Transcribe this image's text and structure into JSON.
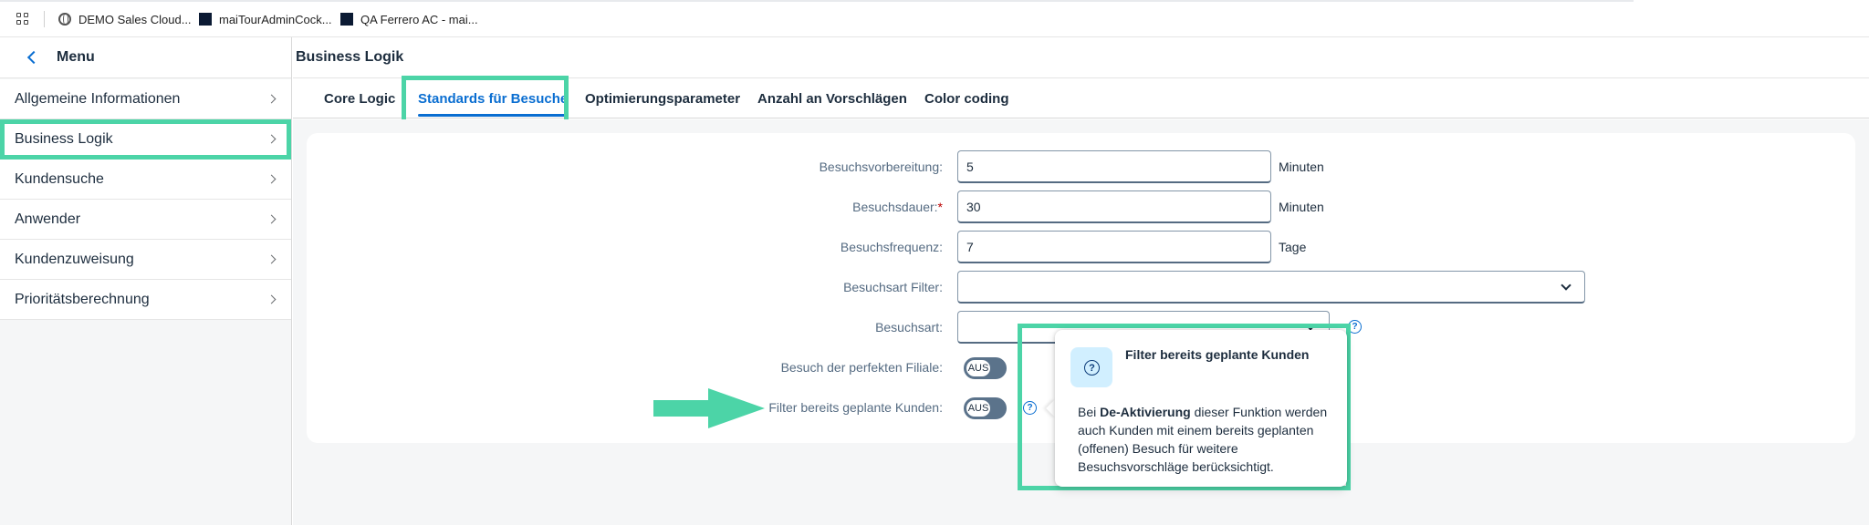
{
  "bookmarks": [
    {
      "label": "DEMO Sales Cloud...",
      "icon": "globe-icon"
    },
    {
      "label": "maiTourAdminCock...",
      "icon": "app-square-icon"
    },
    {
      "label": "QA Ferrero AC - mai...",
      "icon": "app-square-icon"
    }
  ],
  "sidebar": {
    "title": "Menu",
    "items": [
      {
        "label": "Allgemeine Informationen"
      },
      {
        "label": "Business Logik"
      },
      {
        "label": "Kundensuche"
      },
      {
        "label": "Anwender"
      },
      {
        "label": "Kundenzuweisung"
      },
      {
        "label": "Prioritätsberechnung"
      }
    ]
  },
  "main": {
    "title": "Business Logik",
    "tabs": [
      {
        "label": "Core Logic"
      },
      {
        "label": "Standards für Besuche"
      },
      {
        "label": "Optimierungsparameter"
      },
      {
        "label": "Anzahl an Vorschlägen"
      },
      {
        "label": "Color coding"
      }
    ],
    "selected_tab": "Standards für Besuche"
  },
  "form": {
    "vorbereitung": {
      "label": "Besuchsvorbereitung:",
      "value": "5",
      "unit": "Minuten"
    },
    "dauer": {
      "label": "Besuchsdauer:",
      "required_mark": "*",
      "value": "30",
      "unit": "Minuten"
    },
    "frequenz": {
      "label": "Besuchsfrequenz:",
      "value": "7",
      "unit": "Tage"
    },
    "art_filter": {
      "label": "Besuchsart Filter:",
      "value": ""
    },
    "art": {
      "label": "Besuchsart:",
      "value": ""
    },
    "perfekte_filiale": {
      "label": "Besuch der perfekten Filiale:",
      "switch_text": "AUS",
      "on": false
    },
    "geplante_kunden": {
      "label": "Filter bereits geplante Kunden:",
      "switch_text": "AUS",
      "on": false
    }
  },
  "popover": {
    "title": "Filter bereits geplante Kunden",
    "body_prefix": "Bei ",
    "body_bold": "De-Aktivierung",
    "body_suffix": " dieser Funktion werden auch Kunden mit einem bereits geplanten (offenen) Besuch für weitere Besuchsvorschläge berücksichtigt."
  },
  "colors": {
    "accent": "#0a6ed1",
    "highlight": "#4cd4a7",
    "required": "#bb0000"
  }
}
